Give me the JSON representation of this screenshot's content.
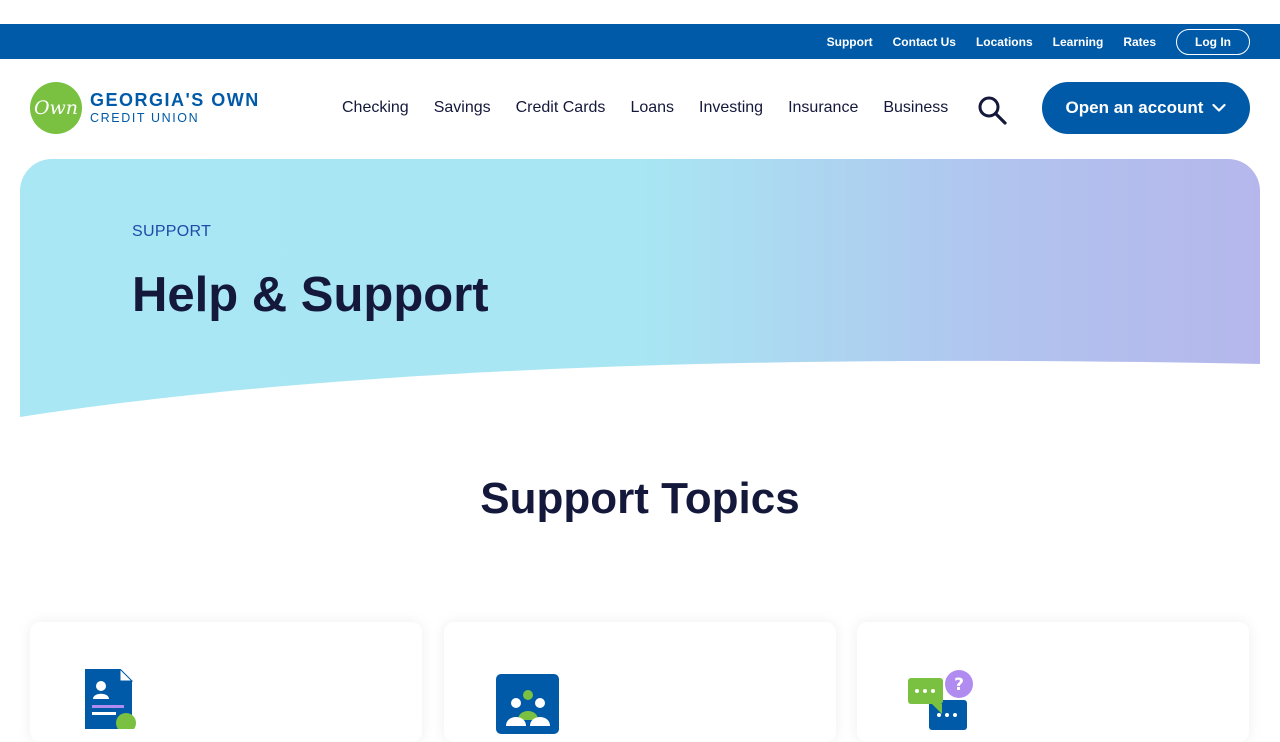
{
  "utility_nav": {
    "links": [
      "Support",
      "Contact Us",
      "Locations",
      "Learning",
      "Rates"
    ],
    "login_label": "Log In"
  },
  "brand": {
    "logo_mark": "Own",
    "name": "GEORGIA'S OWN",
    "subtitle": "CREDIT UNION",
    "colors": {
      "primary": "#005aa7",
      "green": "#7ac142",
      "dark_text": "#14183a"
    }
  },
  "main_nav": {
    "links": [
      "Checking",
      "Savings",
      "Credit Cards",
      "Loans",
      "Investing",
      "Insurance",
      "Business"
    ],
    "search_icon": "search-icon",
    "cta_label": "Open an account"
  },
  "hero": {
    "eyebrow": "SUPPORT",
    "title": "Help & Support"
  },
  "topics": {
    "title": "Support Topics",
    "cards": [
      {
        "icon": "document-person-icon"
      },
      {
        "icon": "people-group-icon"
      },
      {
        "icon": "chat-question-icon"
      }
    ]
  }
}
